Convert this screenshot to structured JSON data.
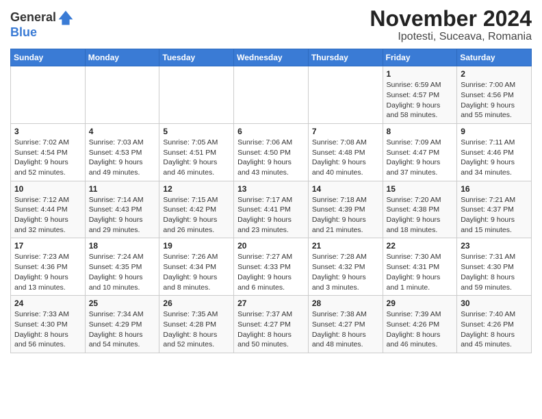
{
  "header": {
    "logo_line1": "General",
    "logo_line2": "Blue",
    "title": "November 2024",
    "subtitle": "Ipotesti, Suceava, Romania"
  },
  "calendar": {
    "days_of_week": [
      "Sunday",
      "Monday",
      "Tuesday",
      "Wednesday",
      "Thursday",
      "Friday",
      "Saturday"
    ],
    "weeks": [
      [
        {
          "day": "",
          "info": ""
        },
        {
          "day": "",
          "info": ""
        },
        {
          "day": "",
          "info": ""
        },
        {
          "day": "",
          "info": ""
        },
        {
          "day": "",
          "info": ""
        },
        {
          "day": "1",
          "info": "Sunrise: 6:59 AM\nSunset: 4:57 PM\nDaylight: 9 hours and 58 minutes."
        },
        {
          "day": "2",
          "info": "Sunrise: 7:00 AM\nSunset: 4:56 PM\nDaylight: 9 hours and 55 minutes."
        }
      ],
      [
        {
          "day": "3",
          "info": "Sunrise: 7:02 AM\nSunset: 4:54 PM\nDaylight: 9 hours and 52 minutes."
        },
        {
          "day": "4",
          "info": "Sunrise: 7:03 AM\nSunset: 4:53 PM\nDaylight: 9 hours and 49 minutes."
        },
        {
          "day": "5",
          "info": "Sunrise: 7:05 AM\nSunset: 4:51 PM\nDaylight: 9 hours and 46 minutes."
        },
        {
          "day": "6",
          "info": "Sunrise: 7:06 AM\nSunset: 4:50 PM\nDaylight: 9 hours and 43 minutes."
        },
        {
          "day": "7",
          "info": "Sunrise: 7:08 AM\nSunset: 4:48 PM\nDaylight: 9 hours and 40 minutes."
        },
        {
          "day": "8",
          "info": "Sunrise: 7:09 AM\nSunset: 4:47 PM\nDaylight: 9 hours and 37 minutes."
        },
        {
          "day": "9",
          "info": "Sunrise: 7:11 AM\nSunset: 4:46 PM\nDaylight: 9 hours and 34 minutes."
        }
      ],
      [
        {
          "day": "10",
          "info": "Sunrise: 7:12 AM\nSunset: 4:44 PM\nDaylight: 9 hours and 32 minutes."
        },
        {
          "day": "11",
          "info": "Sunrise: 7:14 AM\nSunset: 4:43 PM\nDaylight: 9 hours and 29 minutes."
        },
        {
          "day": "12",
          "info": "Sunrise: 7:15 AM\nSunset: 4:42 PM\nDaylight: 9 hours and 26 minutes."
        },
        {
          "day": "13",
          "info": "Sunrise: 7:17 AM\nSunset: 4:41 PM\nDaylight: 9 hours and 23 minutes."
        },
        {
          "day": "14",
          "info": "Sunrise: 7:18 AM\nSunset: 4:39 PM\nDaylight: 9 hours and 21 minutes."
        },
        {
          "day": "15",
          "info": "Sunrise: 7:20 AM\nSunset: 4:38 PM\nDaylight: 9 hours and 18 minutes."
        },
        {
          "day": "16",
          "info": "Sunrise: 7:21 AM\nSunset: 4:37 PM\nDaylight: 9 hours and 15 minutes."
        }
      ],
      [
        {
          "day": "17",
          "info": "Sunrise: 7:23 AM\nSunset: 4:36 PM\nDaylight: 9 hours and 13 minutes."
        },
        {
          "day": "18",
          "info": "Sunrise: 7:24 AM\nSunset: 4:35 PM\nDaylight: 9 hours and 10 minutes."
        },
        {
          "day": "19",
          "info": "Sunrise: 7:26 AM\nSunset: 4:34 PM\nDaylight: 9 hours and 8 minutes."
        },
        {
          "day": "20",
          "info": "Sunrise: 7:27 AM\nSunset: 4:33 PM\nDaylight: 9 hours and 6 minutes."
        },
        {
          "day": "21",
          "info": "Sunrise: 7:28 AM\nSunset: 4:32 PM\nDaylight: 9 hours and 3 minutes."
        },
        {
          "day": "22",
          "info": "Sunrise: 7:30 AM\nSunset: 4:31 PM\nDaylight: 9 hours and 1 minute."
        },
        {
          "day": "23",
          "info": "Sunrise: 7:31 AM\nSunset: 4:30 PM\nDaylight: 8 hours and 59 minutes."
        }
      ],
      [
        {
          "day": "24",
          "info": "Sunrise: 7:33 AM\nSunset: 4:30 PM\nDaylight: 8 hours and 56 minutes."
        },
        {
          "day": "25",
          "info": "Sunrise: 7:34 AM\nSunset: 4:29 PM\nDaylight: 8 hours and 54 minutes."
        },
        {
          "day": "26",
          "info": "Sunrise: 7:35 AM\nSunset: 4:28 PM\nDaylight: 8 hours and 52 minutes."
        },
        {
          "day": "27",
          "info": "Sunrise: 7:37 AM\nSunset: 4:27 PM\nDaylight: 8 hours and 50 minutes."
        },
        {
          "day": "28",
          "info": "Sunrise: 7:38 AM\nSunset: 4:27 PM\nDaylight: 8 hours and 48 minutes."
        },
        {
          "day": "29",
          "info": "Sunrise: 7:39 AM\nSunset: 4:26 PM\nDaylight: 8 hours and 46 minutes."
        },
        {
          "day": "30",
          "info": "Sunrise: 7:40 AM\nSunset: 4:26 PM\nDaylight: 8 hours and 45 minutes."
        }
      ]
    ]
  }
}
